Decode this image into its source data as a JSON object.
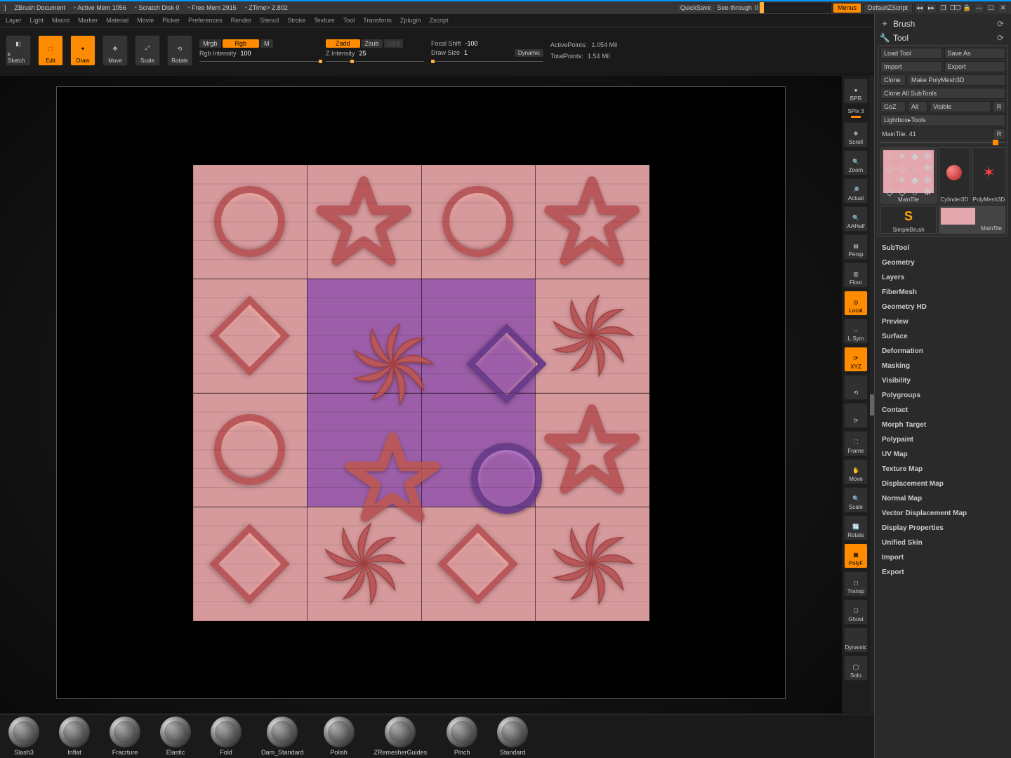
{
  "titlebar": {
    "doc": "ZBrush Document",
    "active_mem": "Active Mem 1056",
    "scratch": "Scratch Disk 0",
    "free_mem": "Free Mem 2915",
    "ztime": "ZTime> 2.802",
    "quicksave": "QuickSave",
    "seethrough_label": "See-through",
    "seethrough_value": "0",
    "menus": "Menus",
    "default_script": "DefaultZScript"
  },
  "menus": [
    "Layer",
    "Light",
    "Macro",
    "Marker",
    "Material",
    "Movie",
    "Picker",
    "Preferences",
    "Render",
    "Stencil",
    "Stroke",
    "Texture",
    "Tool",
    "Transform",
    "Zplugin",
    "Zscript"
  ],
  "toolstrip": {
    "sketch": "k Sketch",
    "edit": "Edit",
    "draw": "Draw",
    "move": "Move",
    "scale": "Scale",
    "rotate": "Rotate",
    "mrgb": "Mrgb",
    "rgb": "Rgb",
    "m": "M",
    "rgb_intensity_label": "Rgb Intensity",
    "rgb_intensity_val": "100",
    "zadd": "Zadd",
    "zsub": "Zsub",
    "zcut": "Zcut",
    "z_intensity_label": "Z Intensity",
    "z_intensity_val": "25",
    "focal_shift_label": "Focal Shift",
    "focal_shift_val": "-100",
    "draw_size_label": "Draw Size",
    "draw_size_val": "1",
    "dynamic": "Dynamic",
    "active_points_label": "ActivePoints:",
    "active_points_val": "1.054 Mil",
    "total_points_label": "TotalPoints:",
    "total_points_val": "1.54 Mil"
  },
  "iconbar": [
    {
      "label": "BPR",
      "on": false,
      "glyph": "●"
    },
    {
      "label": "SPix 3",
      "on": false,
      "glyph": ""
    },
    {
      "label": "Scroll",
      "on": false,
      "glyph": "✥"
    },
    {
      "label": "Zoom",
      "on": false,
      "glyph": "🔍"
    },
    {
      "label": "Actual",
      "on": false,
      "glyph": "🔎"
    },
    {
      "label": "AAHalf",
      "on": false,
      "glyph": "🔍"
    },
    {
      "label": "Persp",
      "on": false,
      "glyph": "▤"
    },
    {
      "label": "Floor",
      "on": false,
      "glyph": "▥"
    },
    {
      "label": "Local",
      "on": true,
      "glyph": "◎"
    },
    {
      "label": "L.Sym",
      "on": false,
      "glyph": "↔"
    },
    {
      "label": "XYZ",
      "on": true,
      "glyph": "⟳"
    },
    {
      "label": "",
      "on": false,
      "glyph": "⟲"
    },
    {
      "label": "",
      "on": false,
      "glyph": "⟳"
    },
    {
      "label": "Frame",
      "on": false,
      "glyph": "⛶"
    },
    {
      "label": "Move",
      "on": false,
      "glyph": "✋"
    },
    {
      "label": "Scale",
      "on": false,
      "glyph": "🔍"
    },
    {
      "label": "Rotate",
      "on": false,
      "glyph": "🔄"
    },
    {
      "label": "PolyF",
      "on": true,
      "glyph": "▦"
    },
    {
      "label": "Transp",
      "on": false,
      "glyph": "◻"
    },
    {
      "label": "Ghost",
      "on": false,
      "glyph": "☐"
    },
    {
      "label": "Dynamic",
      "on": false,
      "glyph": ""
    },
    {
      "label": "Solo",
      "on": false,
      "glyph": "◯"
    }
  ],
  "rightpanel": {
    "brush": "Brush",
    "tool": "Tool",
    "buttons": {
      "load": "Load Tool",
      "saveas": "Save As",
      "import": "Import",
      "export": "Export",
      "clone": "Clone",
      "makepm": "Make PolyMesh3D",
      "cloneall": "Clone All SubTools",
      "goz": "GoZ",
      "all": "All",
      "visible": "Visible",
      "r": "R",
      "lightbox": "Lightbox▸Tools",
      "maintile_label": "MainTile.",
      "maintile_num": "41"
    },
    "tools": {
      "maintile": "MainTile",
      "cylinder": "Cylinder3D",
      "polymesh": "PolyMesh3D",
      "simplebrush": "SimpleBrush",
      "maintile2": "MainTile"
    },
    "sections": [
      "SubTool",
      "Geometry",
      "Layers",
      "FiberMesh",
      "Geometry HD",
      "Preview",
      "Surface",
      "Deformation",
      "Masking",
      "Visibility",
      "Polygroups",
      "Contact",
      "Morph Target",
      "Polypaint",
      "UV Map",
      "Texture Map",
      "Displacement Map",
      "Normal Map",
      "Vector Displacement Map",
      "Display Properties",
      "Unified Skin",
      "Import",
      "Export"
    ]
  },
  "brushes": [
    {
      "label": "Slash3"
    },
    {
      "label": "Inflat"
    },
    {
      "label": "Fracrture"
    },
    {
      "label": "Elastic"
    },
    {
      "label": "Fold"
    },
    {
      "label": "Dam_Standard"
    },
    {
      "label": "Polish"
    },
    {
      "label": "ZRemesherGuides"
    },
    {
      "label": "Pinch"
    },
    {
      "label": "Standard"
    }
  ],
  "canvas_grid": [
    [
      "circle",
      "star",
      "circle",
      "star"
    ],
    [
      "diamond",
      "swirl",
      "diamond",
      "swirl"
    ],
    [
      "circle",
      "star",
      "circle",
      "star"
    ],
    [
      "diamond",
      "swirl",
      "diamond",
      "swirl"
    ]
  ]
}
